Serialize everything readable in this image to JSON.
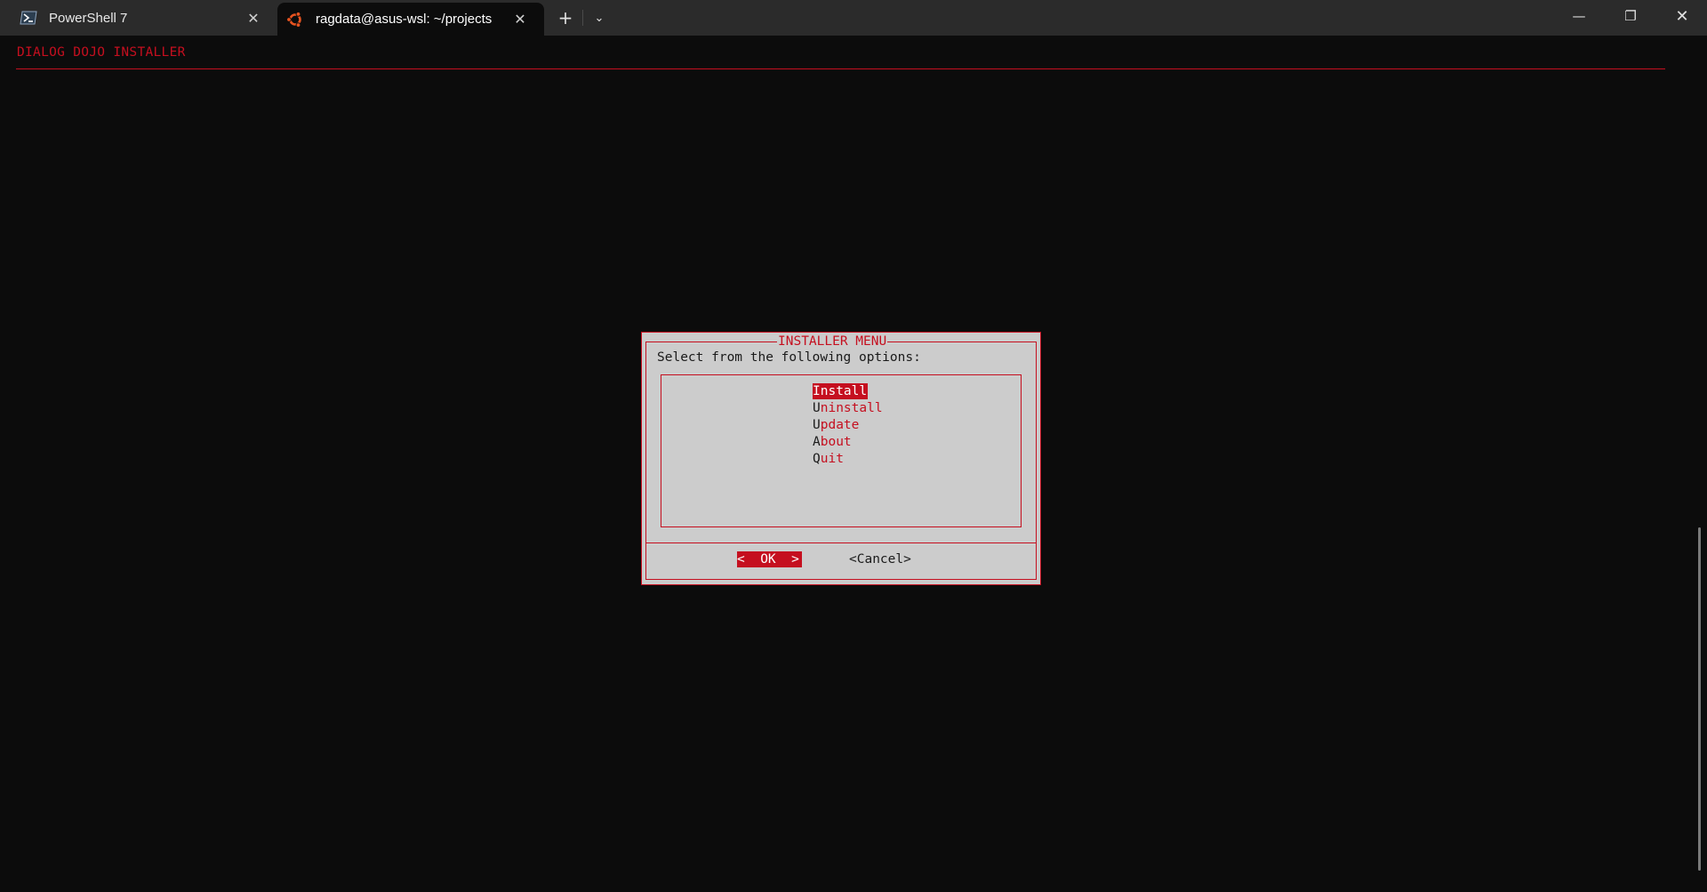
{
  "tabs": [
    {
      "title": "PowerShell 7",
      "icon": "powershell-icon",
      "close": "✕"
    },
    {
      "title": "ragdata@asus-wsl: ~/projects",
      "icon": "ubuntu-icon",
      "close": "✕",
      "accent": "#e95420"
    }
  ],
  "titlebar": {
    "new_tab": "+",
    "dropdown": "⌄",
    "minimize": "—",
    "maximize": "❐",
    "close": "✕"
  },
  "terminal": {
    "header_title": "DIALOG DOJO INSTALLER",
    "dialog": {
      "title": "INSTALLER MENU",
      "prompt": "Select from the following options:",
      "items": [
        {
          "hot": "I",
          "rest": "nstall",
          "selected": true
        },
        {
          "hot": "U",
          "rest": "ninstall",
          "selected": false
        },
        {
          "hot": "U",
          "rest": "pdate",
          "selected": false
        },
        {
          "hot": "A",
          "rest": "bout",
          "selected": false
        },
        {
          "hot": "Q",
          "rest": "uit",
          "selected": false
        }
      ],
      "ok_label": "<  OK  >",
      "cancel_label": "<Cancel>"
    }
  },
  "colors": {
    "accent": "#c50f1f",
    "dialog_bg": "#cccccc",
    "terminal_bg": "#0c0c0c",
    "titlebar_bg": "#2b2b2b"
  }
}
